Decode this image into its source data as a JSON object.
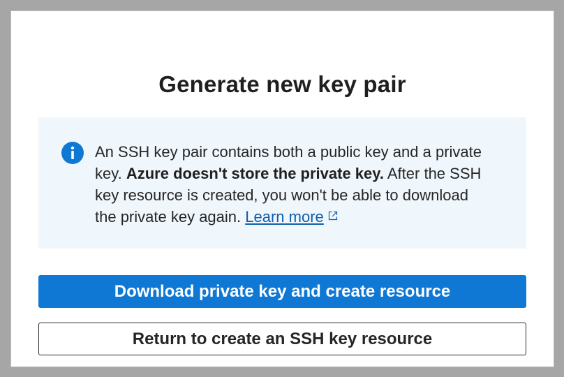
{
  "dialog": {
    "title": "Generate new key pair",
    "info": {
      "icon": "info-icon",
      "text_part1": "An SSH key pair contains both a public key and a private key. ",
      "text_bold": "Azure doesn't store the private key.",
      "text_part2": " After the SSH key resource is created, you won't be able to download the private key again. ",
      "link_label": "Learn more",
      "link_icon": "external-link-icon"
    },
    "primary_button_label": "Download private key and create resource",
    "secondary_button_label": "Return to create an SSH key resource"
  },
  "colors": {
    "accent": "#0f78d4",
    "info_background": "#eff6fc",
    "link": "#0f5ea8",
    "overlay": "#a6a6a6"
  }
}
